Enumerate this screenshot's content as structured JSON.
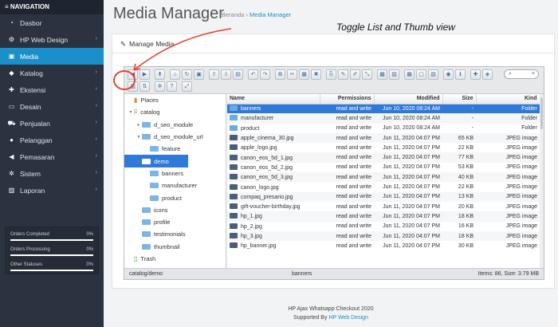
{
  "sidebar": {
    "header": "≡ NAVIGATION",
    "items": [
      {
        "icon": "dashboard-icon",
        "glyph": "◔",
        "label": "Dasbor",
        "chevron": false,
        "active": false
      },
      {
        "icon": "cogs-icon",
        "glyph": "⚙",
        "label": "HP Web Design",
        "chevron": true,
        "active": false
      },
      {
        "icon": "image-icon",
        "glyph": "▣",
        "label": "Media",
        "chevron": false,
        "active": true
      },
      {
        "icon": "tag-icon",
        "glyph": "◆",
        "label": "Katalog",
        "chevron": true,
        "active": false
      },
      {
        "icon": "puzzle-icon",
        "glyph": "✚",
        "label": "Ekstensi",
        "chevron": true,
        "active": false
      },
      {
        "icon": "desktop-icon",
        "glyph": "▭",
        "label": "Desain",
        "chevron": true,
        "active": false
      },
      {
        "icon": "cart-icon",
        "glyph": "⛟",
        "label": "Penjualan",
        "chevron": true,
        "active": false
      },
      {
        "icon": "user-icon",
        "glyph": "●",
        "label": "Pelanggan",
        "chevron": true,
        "active": false
      },
      {
        "icon": "share-icon",
        "glyph": "◀",
        "label": "Pemasaran",
        "chevron": true,
        "active": false
      },
      {
        "icon": "gear-icon",
        "glyph": "✲",
        "label": "Sistem",
        "chevron": true,
        "active": false
      },
      {
        "icon": "bar-chart-icon",
        "glyph": "▥",
        "label": "Laporan",
        "chevron": true,
        "active": false
      }
    ],
    "stats": [
      {
        "name": "Orders Completed",
        "pct": "0%"
      },
      {
        "name": "Orders Processing",
        "pct": "0%"
      },
      {
        "name": "Other Statuses",
        "pct": "0%"
      }
    ]
  },
  "header": {
    "title": "Media Manager",
    "breadcrumb_home": "Beranda",
    "breadcrumb_sep": "›",
    "breadcrumb_current": "Media Manager",
    "annotation": "Toggle List and Thumb view"
  },
  "panel": {
    "title": "Manage Media",
    "search_placeholder": "",
    "tree": [
      {
        "label": "Places",
        "depth": 0,
        "arrow": "",
        "icon": "places-icon"
      },
      {
        "label": "catalog",
        "depth": 0,
        "arrow": "▾",
        "icon": "drive-icon"
      },
      {
        "label": "d_seo_module",
        "depth": 1,
        "arrow": "▸"
      },
      {
        "label": "d_seo_module_url",
        "depth": 1,
        "arrow": "▾"
      },
      {
        "label": "feature",
        "depth": 2,
        "arrow": ""
      },
      {
        "label": "demo",
        "depth": 1,
        "arrow": "▾",
        "selected": true
      },
      {
        "label": "banners",
        "depth": 2,
        "arrow": ""
      },
      {
        "label": "manufacturer",
        "depth": 2,
        "arrow": ""
      },
      {
        "label": "product",
        "depth": 2,
        "arrow": ""
      },
      {
        "label": "icons",
        "depth": 1,
        "arrow": ""
      },
      {
        "label": "profile",
        "depth": 1,
        "arrow": ""
      },
      {
        "label": "testimonials",
        "depth": 1,
        "arrow": ""
      },
      {
        "label": "thumbnail",
        "depth": 1,
        "arrow": ""
      },
      {
        "label": "Trash",
        "depth": 0,
        "arrow": "",
        "icon": "trash-icon"
      }
    ],
    "columns": {
      "name": "Name",
      "permissions": "Permissions",
      "modified": "Modified",
      "size": "Size",
      "kind": "Kind"
    },
    "files": [
      {
        "name": "banners",
        "perm": "read and write",
        "mod": "Jun 10, 2020 08:24 AM",
        "size": "-",
        "kind": "Folder",
        "dir": true,
        "sel": true
      },
      {
        "name": "manufacturer",
        "perm": "read and write",
        "mod": "Jun 10, 2020 08:24 AM",
        "size": "-",
        "kind": "Folder",
        "dir": true
      },
      {
        "name": "product",
        "perm": "read and write",
        "mod": "Jun 10, 2020 08:24 AM",
        "size": "-",
        "kind": "Folder",
        "dir": true
      },
      {
        "name": "apple_cinema_30.jpg",
        "perm": "read and write",
        "mod": "Jun 11, 2020 04:07 PM",
        "size": "65 KB",
        "kind": "JPEG image"
      },
      {
        "name": "apple_logo.jpg",
        "perm": "read and write",
        "mod": "Jun 11, 2020 04:07 PM",
        "size": "22 KB",
        "kind": "JPEG image"
      },
      {
        "name": "canon_eos_5d_1.jpg",
        "perm": "read and write",
        "mod": "Jun 11, 2020 04:07 PM",
        "size": "77 KB",
        "kind": "JPEG image"
      },
      {
        "name": "canon_eos_5d_2.jpg",
        "perm": "read and write",
        "mod": "Jun 11, 2020 04:07 PM",
        "size": "53 KB",
        "kind": "JPEG image"
      },
      {
        "name": "canon_eos_5d_3.jpg",
        "perm": "read and write",
        "mod": "Jun 11, 2020 04:07 PM",
        "size": "40 KB",
        "kind": "JPEG image"
      },
      {
        "name": "canon_logo.jpg",
        "perm": "read and write",
        "mod": "Jun 11, 2020 04:07 PM",
        "size": "22 KB",
        "kind": "JPEG image"
      },
      {
        "name": "compaq_presario.jpg",
        "perm": "read and write",
        "mod": "Jun 11, 2020 04:07 PM",
        "size": "13 KB",
        "kind": "JPEG image"
      },
      {
        "name": "gift-voucher-birthday.jpg",
        "perm": "read and write",
        "mod": "Jun 11, 2020 04:07 PM",
        "size": "20 KB",
        "kind": "JPEG image"
      },
      {
        "name": "hp_1.jpg",
        "perm": "read and write",
        "mod": "Jun 11, 2020 04:07 PM",
        "size": "18 KB",
        "kind": "JPEG image"
      },
      {
        "name": "hp_2.jpg",
        "perm": "read and write",
        "mod": "Jun 11, 2020 04:07 PM",
        "size": "16 KB",
        "kind": "JPEG image"
      },
      {
        "name": "hp_3.jpg",
        "perm": "read and write",
        "mod": "Jun 11, 2020 04:07 PM",
        "size": "18 KB",
        "kind": "JPEG image"
      },
      {
        "name": "hp_banner.jpg",
        "perm": "read and write",
        "mod": "Jun 11, 2020 04:07 PM",
        "size": "30 KB",
        "kind": "JPEG image"
      }
    ],
    "status_path": "catalog/demo",
    "status_selected": "banners",
    "status_items": "Items: 86, Size: 3.79 MB"
  },
  "footer": {
    "line1": "HP Ajax Whatsapp Checkout 2020",
    "line2_prefix": "Supported By ",
    "line2_link": "HP Web Design"
  },
  "colors": {
    "accent": "#1a8fc9",
    "selection": "#2f7ad8",
    "annotation": "#e4452c",
    "sidebar": "#2b3340"
  }
}
